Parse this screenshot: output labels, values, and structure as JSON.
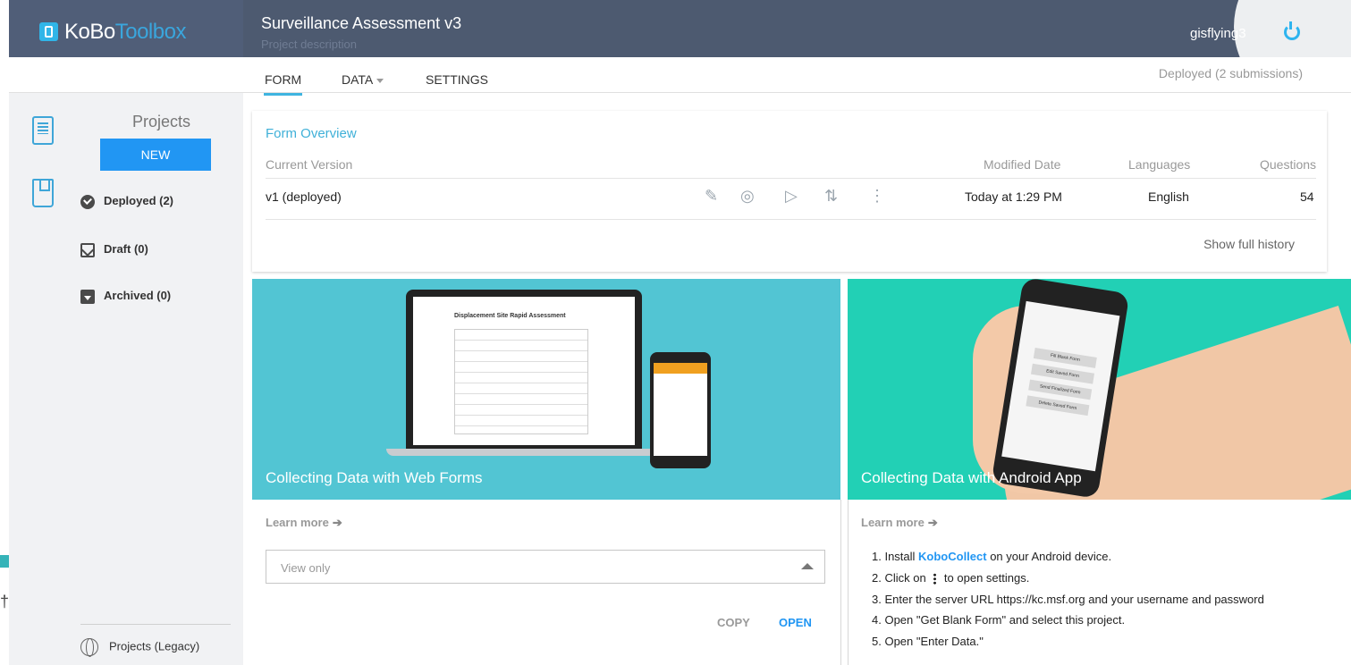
{
  "header": {
    "logo": {
      "part1": "KoBo",
      "part2": "Toolbox"
    },
    "project_title": "Surveillance Assessment v3",
    "project_description": "Project description",
    "username": "gisflying3",
    "colors": {
      "header_bg": "#4d5a70",
      "accent": "#2eb4ef"
    }
  },
  "subnav": {
    "tabs": [
      {
        "label": "FORM",
        "active": true
      },
      {
        "label": "DATA",
        "active": false
      },
      {
        "label": "SETTINGS",
        "active": false
      }
    ],
    "status": "Deployed (2 submissions)"
  },
  "sidebar": {
    "heading": "Projects",
    "new_button": "NEW",
    "items": [
      {
        "label": "Deployed (2)",
        "icon": "check-circle-icon"
      },
      {
        "label": "Draft (0)",
        "icon": "envelope-open-icon"
      },
      {
        "label": "Archived (0)",
        "icon": "archive-icon"
      }
    ],
    "legacy": "Projects (Legacy)"
  },
  "overview": {
    "title": "Form Overview",
    "columns": {
      "version": "Current Version",
      "modified": "Modified Date",
      "languages": "Languages",
      "questions": "Questions"
    },
    "row": {
      "version": "v1 (deployed)",
      "modified": "Today at 1:29 PM",
      "languages": "English",
      "questions": "54"
    },
    "actions": [
      "edit-icon",
      "preview-icon",
      "play-icon",
      "sort-icon",
      "more-icon"
    ],
    "history_link": "Show full history"
  },
  "web_forms": {
    "caption": "Collecting Data with Web Forms",
    "doc_title": "Displacement Site Rapid Assessment",
    "learn_more": "Learn more",
    "view_select": "View only",
    "copy_button": "COPY",
    "open_button": "OPEN"
  },
  "android": {
    "caption": "Collecting Data with Android App",
    "learn_more": "Learn more",
    "phone_buttons": [
      "Fill Blank Form",
      "Edit Saved Form",
      "Send Finalized Form",
      "Delete Saved Form"
    ],
    "steps": {
      "s1_pre": "1. Install ",
      "s1_link": "KoboCollect",
      "s1_post": " on your Android device.",
      "s2_pre": "2. Click on ",
      "s2_post": " to open settings.",
      "s3": "3. Enter the server URL https://kc.msf.org and your username and password",
      "s4": "4. Open \"Get Blank Form\" and select this project.",
      "s5": "5. Open \"Enter Data.\""
    }
  }
}
